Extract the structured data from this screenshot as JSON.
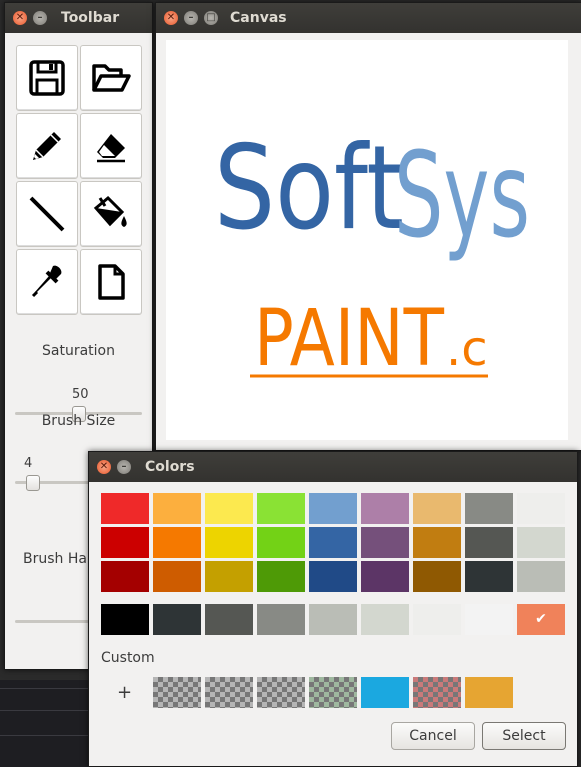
{
  "toolbar_window": {
    "title": "Toolbar",
    "tools": [
      {
        "id": "save",
        "icon": "save-icon"
      },
      {
        "id": "open",
        "icon": "folder-open-icon"
      },
      {
        "id": "pencil",
        "icon": "pencil-icon"
      },
      {
        "id": "eraser",
        "icon": "eraser-icon"
      },
      {
        "id": "line",
        "icon": "line-icon"
      },
      {
        "id": "fill",
        "icon": "paint-bucket-icon"
      },
      {
        "id": "eyedropper",
        "icon": "eyedropper-icon"
      },
      {
        "id": "new",
        "icon": "new-file-icon"
      }
    ],
    "saturation_label": "Saturation",
    "saturation_value": "50",
    "saturation_level": 0.5,
    "brush_size_label": "Brush Size",
    "brush_size_value": "4",
    "brush_size_level": 0.04,
    "brush_hardness_label": "Brush Har"
  },
  "canvas_window": {
    "title": "Canvas",
    "drawing": {
      "line1_part1": "Soft",
      "line1_part2": "Sys",
      "line2_main": "PAINT",
      "line2_ext": ".c",
      "colors": {
        "soft": "#3465a4",
        "sys": "#729fcf",
        "paint": "#f57900"
      }
    }
  },
  "colors_dialog": {
    "title": "Colors",
    "palette": [
      [
        "#ef2929",
        "#fcaf3e",
        "#fce94f",
        "#8ae234",
        "#729fcf",
        "#ad7fa8",
        "#e9b96e",
        "#888a85",
        "#eeeeec"
      ],
      [
        "#cc0000",
        "#f57900",
        "#edd400",
        "#73d216",
        "#3465a4",
        "#75507b",
        "#c17d11",
        "#555753",
        "#d3d7cf"
      ],
      [
        "#a40000",
        "#ce5c00",
        "#c4a000",
        "#4e9a06",
        "#204a87",
        "#5c3566",
        "#8f5902",
        "#2e3436",
        "#babdb6"
      ]
    ],
    "grays": [
      "#000000",
      "#2e3436",
      "#555753",
      "#888a85",
      "#babdb6",
      "#d3d7cf",
      "#eeeeec",
      "#f3f3f3",
      "#f0825a"
    ],
    "selected_color": "#f0825a",
    "custom_label": "Custom",
    "add_label": "+",
    "custom_colors": [
      "checker",
      "checker",
      "checker",
      "checker-green",
      "#1ba8e0",
      "checker-red",
      "#e6a532"
    ],
    "cancel_label": "Cancel",
    "select_label": "Select"
  }
}
